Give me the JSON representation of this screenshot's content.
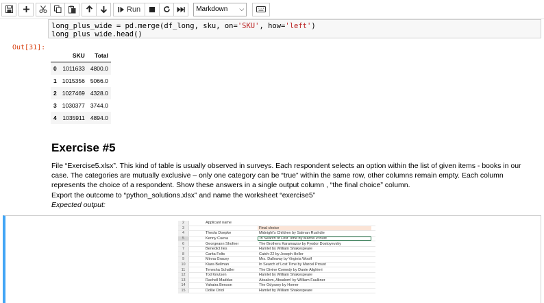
{
  "toolbar": {
    "run_label": "Run",
    "cell_type": "Markdown"
  },
  "code": {
    "line1_prefix": "long_plus_wide = pd.merge(df_long, sku, on=",
    "line1_on": "'SKU'",
    "line1_mid": ", how=",
    "line1_how": "'left'",
    "line1_suffix": ")",
    "line2": "long_plus_wide.head()"
  },
  "output_prompt": "Out[31]:",
  "dataframe": {
    "columns": [
      "SKU",
      "Total"
    ],
    "rows": [
      {
        "index": "0",
        "sku": "1011633",
        "total": "4800.0"
      },
      {
        "index": "1",
        "sku": "1015356",
        "total": "5066.0"
      },
      {
        "index": "2",
        "sku": "1027469",
        "total": "4328.0"
      },
      {
        "index": "3",
        "sku": "1030377",
        "total": "3744.0"
      },
      {
        "index": "4",
        "sku": "1035911",
        "total": "4894.0"
      }
    ]
  },
  "markdown": {
    "title": "Exercise #5",
    "para1": "File “Exercise5.xlsx”. This kind of table is usually observed in surveys. Each respondent selects an option within the list of given items - books in our case. The categories are mutually exclusive – only one category can be “true” within the same row, other columns remain empty. Each column represents the choice of a respondent. Show these answers in a single output column , “the final choice” column.",
    "para2": "Export the outcome to “python_solutions.xlsx” and name the worksheet “exercise5”",
    "para3": "Expected output:"
  },
  "sheet": {
    "header_a": "Applicant name",
    "header_b": "Final choice",
    "rows": [
      {
        "n": "4",
        "name": "Theola Doepke",
        "choice": "Midnight's Children by Salman Rushdie"
      },
      {
        "n": "5",
        "name": "Kenny Cueva",
        "choice": "In Search of Lost Time by Marcel Proust"
      },
      {
        "n": "6",
        "name": "Georgeann Shofner",
        "choice": "The Brothers Karamazov by Fyodor Dostoyevsky"
      },
      {
        "n": "7",
        "name": "Benedict Iles",
        "choice": "Hamlet by William Shakespeare"
      },
      {
        "n": "8",
        "name": "Carita Folts",
        "choice": "Catch-22 by Joseph Heller"
      },
      {
        "n": "9",
        "name": "Minna Gracey",
        "choice": "Mrs. Dalloway by Virginia Woolf"
      },
      {
        "n": "10",
        "name": "Kiara Bellman",
        "choice": "In Search of Lost Time by Marcel Proust"
      },
      {
        "n": "11",
        "name": "Tenesha Schaller",
        "choice": "The Divine Comedy by Dante Alighieri"
      },
      {
        "n": "12",
        "name": "Tod Knutsen",
        "choice": "Hamlet by William Shakespeare"
      },
      {
        "n": "13",
        "name": "Rachell Maddux",
        "choice": "Absalom, Absalom! by William Faulkner"
      },
      {
        "n": "14",
        "name": "Yahaira Benson",
        "choice": "The Odyssey by Homer"
      },
      {
        "n": "15",
        "name": "Dollie Oriol",
        "choice": "Hamlet by William Shakespeare"
      }
    ]
  }
}
